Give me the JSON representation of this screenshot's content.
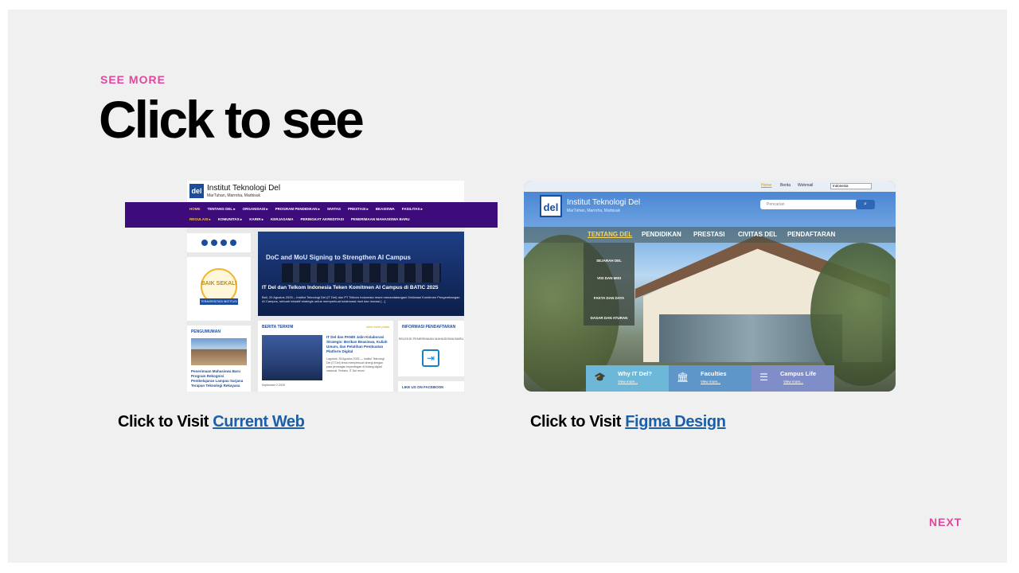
{
  "header": {
    "eyebrow": "SEE MORE",
    "title": "Click to see"
  },
  "current_web": {
    "site_name": "Institut Teknologi Del",
    "tagline": "MarTuhan, Marroha, Marbisuk",
    "logo_text": "del",
    "nav_row1": [
      "HOME",
      "TENTANG DEL ▸",
      "ORGANISASI ▸",
      "PROGRAM PENDIDIKAN ▸",
      "SIVITAS",
      "PRESTASI ▸",
      "BEASISWA",
      "FASILITAS ▸"
    ],
    "nav_row2": [
      "REGULASI ▸",
      "KOMUNITAS ▸",
      "KARIR ▸",
      "KERJASAMA",
      "PERINGKAT AKREDITASI",
      "PENERIMAAN MAHASISWA BARU"
    ],
    "badge_text": "BAIK SEKALI",
    "badge_ribbon": "TERAKREDITASI INSTITUSI",
    "hero_banner": "DoC and MoU Signing to Strengthen AI Campus",
    "hero_caption": "IT Del dan Telkom Indonesia Teken Komitmen AI Campus di BATIC 2025",
    "hero_sub": "Bali, 20 Agustus 2025 – Institut Teknologi Del (IT Del) dan PT Telkom Indonesia resmi menandatangani Deklarasi Komitmen Pengembangan AI Campus, sebuah inisiatif strategis untuk memperkuat kolaborasi riset dan inovasi [...]",
    "pengumuman_title": "PENGUMUMAN",
    "pengumuman_text": "Penerimaan Mahasiswa Baru Program Rekognisi Pembelajaran Lampau Sarjana Terapan Teknologi Rekayasa",
    "berita_title": "BERITA TERKINI",
    "berita_more": "view more posts",
    "berita_headline": "IT Del dan PANDI Jalin Kolaborasi Strategis: Berikan Beasiswa, Kuliah Umum, dan Pelatihan Pembuatan Platform Digital",
    "berita_excerpt": "Laguboti, 28 Agustus 2025 — Institut Teknologi Del (IT Del) terus memperkuat sinergi dengan para pemangku kepentingan di bidang digital nasional. Terbaru, IT Del resmi",
    "berita_date": "September 2 2025",
    "info_title": "INFORMASI PENDAFTARAN",
    "info_sub": "SELEKSI PENERIMAAN MAHASISWA BARU",
    "info2_title": "LIKE US ON FACEBOOK"
  },
  "figma_design": {
    "top_links": [
      "Home",
      "Berita",
      "Webmail"
    ],
    "language": "Indonesia",
    "site_name": "Institut Teknologi Del",
    "tagline": "MarTuhan, Marroha, Marbisuk",
    "logo_text": "del",
    "search_placeholder": "Pencarian",
    "menu": [
      "TENTANG DEL",
      "PENDIDIKAN",
      "PRESTASI",
      "CIVITAS DEL",
      "PENDAFTARAN"
    ],
    "dropdown": [
      "SEJARAH DEL",
      "VISI DAN MISI",
      "FAKTA DAN DATA",
      "DASAR DAN ATURAN"
    ],
    "cards": [
      {
        "title": "Why IT Del?",
        "link": "View more...",
        "color": "#6db7d8"
      },
      {
        "title": "Faculties",
        "link": "View more...",
        "color": "#5f96c9"
      },
      {
        "title": "Campus Life",
        "link": "View more...",
        "color": "#7f8ec9"
      }
    ]
  },
  "captions": {
    "left_prefix": "Click to Visit ",
    "left_link": "Current Web",
    "right_prefix": "Click to Visit ",
    "right_link": "Figma Design"
  },
  "footer": {
    "next_label": "NEXT"
  },
  "colors": {
    "accent": "#e0479e",
    "link": "#1b5fa8",
    "nav_purple": "#3d0c7a"
  }
}
